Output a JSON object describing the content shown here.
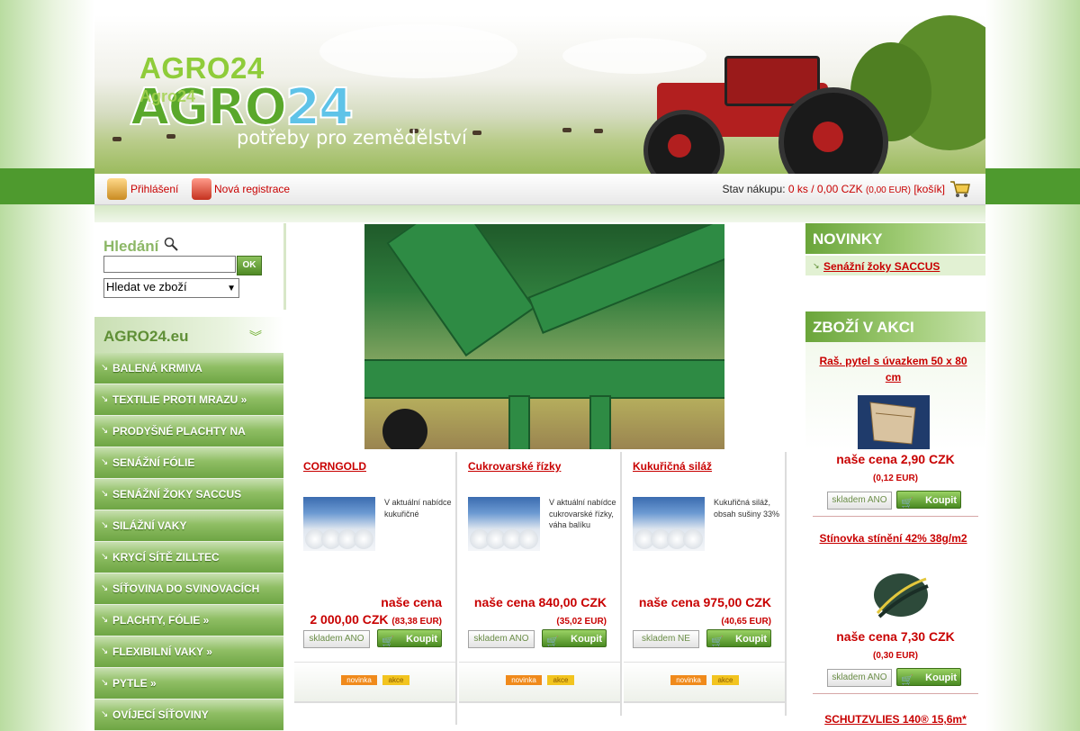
{
  "header": {
    "site_title": "AGRO24",
    "site_title_shadow": "Agro24",
    "logo_left": "AGRO",
    "logo_right": "24",
    "tagline": "potřeby pro zemědělství"
  },
  "userbar": {
    "login": "Přihlášení",
    "register": "Nová registrace",
    "cart_label": "Stav nákupu:",
    "cart_value": "0 ks / 0,00 CZK",
    "cart_eur": "(0,00 EUR)",
    "cart_link": "[košík]"
  },
  "search": {
    "title": "Hledání",
    "input_value": "",
    "ok": "OK",
    "scope": "Hledat ve zboží"
  },
  "categories": {
    "title": "AGRO24.eu",
    "items": [
      {
        "label": "BALENÁ KRMIVA"
      },
      {
        "label": "TEXTILIE PROTI MRAZU »"
      },
      {
        "label": "PRODYŠNÉ PLACHTY NA"
      },
      {
        "label": "SENÁŽNÍ FÓLIE"
      },
      {
        "label": "SENÁŽNÍ ŽOKY SACCUS"
      },
      {
        "label": "SILÁŽNÍ VAKY"
      },
      {
        "label": "KRYCÍ SÍTĚ ZILLTEC"
      },
      {
        "label": "SÍŤOVINA DO SVINOVACÍCH"
      },
      {
        "label": "PLACHTY, FÓLIE »"
      },
      {
        "label": "FLEXIBILNÍ VAKY »"
      },
      {
        "label": "PYTLE »"
      },
      {
        "label": "OVÍJECÍ SÍŤOVINY"
      }
    ]
  },
  "products": [
    {
      "title": "CORNGOLD",
      "desc": "V aktuální nabídce kukuřičné",
      "price_label": "naše cena",
      "price": "2 000,00 CZK",
      "eur": "(83,38 EUR)",
      "stock": "skladem ANO",
      "buy": "Koupit",
      "tag_new": "novinka",
      "tag_sale": "akce"
    },
    {
      "title": "Cukrovarské řízky",
      "desc": "V aktuální nabídce cukrovarské řízky, váha balíku",
      "price_label": "naše cena",
      "price": "840,00 CZK",
      "eur": "(35,02 EUR)",
      "stock": "skladem ANO",
      "buy": "Koupit",
      "tag_new": "novinka",
      "tag_sale": "akce"
    },
    {
      "title": "Kukuřičná siláž",
      "desc": "Kukuřičná siláž, obsah sušiny 33%",
      "price_label": "naše cena",
      "price": "975,00 CZK",
      "eur": "(40,65 EUR)",
      "stock": "skladem NE",
      "buy": "Koupit",
      "tag_new": "novinka",
      "tag_sale": "akce"
    }
  ],
  "news": {
    "title": "NOVINKY",
    "items": [
      {
        "label": "Senážní žoky SACCUS"
      }
    ]
  },
  "sale": {
    "title": "ZBOŽÍ V AKCI",
    "items": [
      {
        "title": "Raš. pytel s úvazkem 50 x 80 cm",
        "price": "naše cena 2,90 CZK",
        "eur": "(0,12 EUR)",
        "stock": "skladem ANO",
        "buy": "Koupit"
      },
      {
        "title": "Stínovka stínění 42% 38g/m2",
        "price": "naše cena 7,30 CZK",
        "eur": "(0,30 EUR)",
        "stock": "skladem ANO",
        "buy": "Koupit"
      },
      {
        "title": "SCHUTZVLIES 140® 15,6m*"
      }
    ]
  }
}
